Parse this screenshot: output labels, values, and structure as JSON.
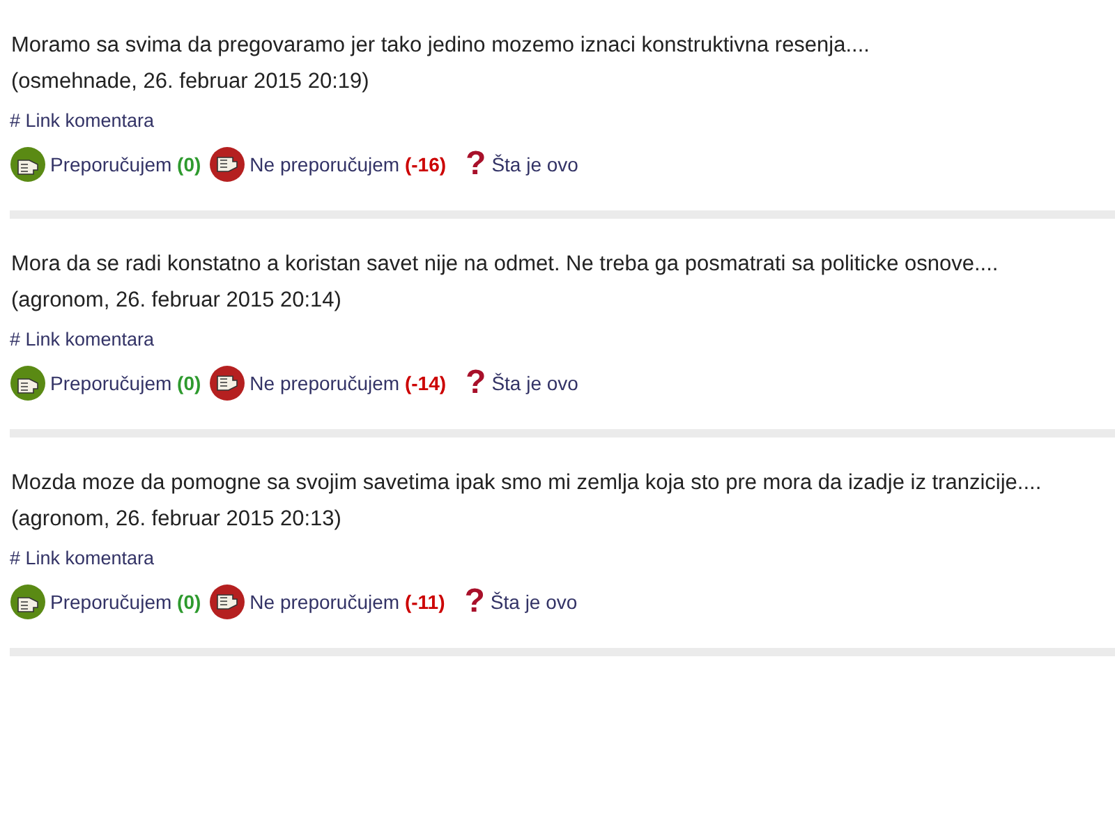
{
  "comments": [
    {
      "text": "Moramo sa svima da pregovaramo jer tako jedino mozemo iznaci konstruktivna resenja....",
      "signature": "(osmehnade, 26. februar 2015 20:19)",
      "link": "# Link komentara",
      "recommend": {
        "label": "Preporučujem",
        "count": "(0)"
      },
      "not_recommend": {
        "label": "Ne preporučujem",
        "count": "(-16)"
      },
      "help": {
        "mark": "?",
        "label": "Šta je ovo"
      }
    },
    {
      "text": "Mora da se radi konstatno a koristan savet nije na odmet. Ne treba ga posmatrati sa politicke osnove....",
      "signature": "(agronom, 26. februar 2015 20:14)",
      "link": "# Link komentara",
      "recommend": {
        "label": "Preporučujem",
        "count": "(0)"
      },
      "not_recommend": {
        "label": "Ne preporučujem",
        "count": "(-14)"
      },
      "help": {
        "mark": "?",
        "label": "Šta je ovo"
      }
    },
    {
      "text": "Mozda moze da pomogne sa svojim savetima ipak smo mi zemlja koja sto pre mora da izadje iz tranzicije....",
      "signature": "(agronom, 26. februar 2015 20:13)",
      "link": "# Link komentara",
      "recommend": {
        "label": "Preporučujem",
        "count": "(0)"
      },
      "not_recommend": {
        "label": "Ne preporučujem",
        "count": "(-11)"
      },
      "help": {
        "mark": "?",
        "label": "Šta je ovo"
      }
    }
  ]
}
